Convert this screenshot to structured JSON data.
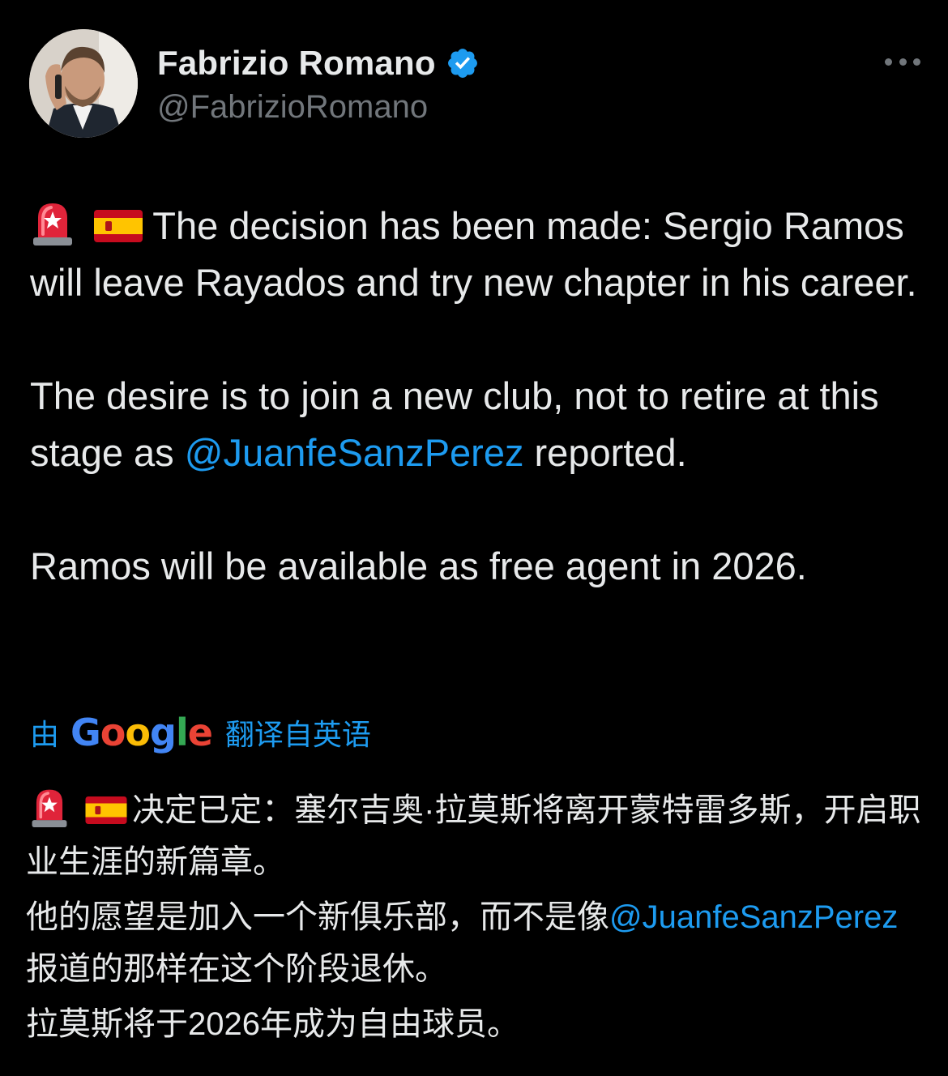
{
  "tweet": {
    "author": {
      "display_name": "Fabrizio Romano",
      "handle": "@FabrizioRomano",
      "verified": true
    },
    "more_icon": "more-horizontal-icon",
    "body": {
      "line1_text": " The decision has been made: Sergio Ramos will leave Rayados and try new chapter in his career.",
      "para2_before": "The desire is to join a new club, not to retire at this stage as ",
      "para2_mention": "@JuanfeSanzPerez",
      "para2_after": " reported.",
      "para3": "Ramos will be available as free agent in 2026."
    },
    "translation": {
      "by_label": "由",
      "provider": "Google",
      "label": "翻译自英语",
      "line1_text": "决定已定：塞尔吉奥·拉莫斯将离开蒙特雷多斯，开启职业生涯的新篇章。",
      "para2_before": "他的愿望是加入一个新俱乐部，而不是像",
      "para2_mention": "@JuanfeSanzPerez",
      "para2_after": "报道的那样在这个阶段退休。",
      "para3": "拉莫斯将于2026年成为自由球员。"
    },
    "emojis": [
      "police-light-icon",
      "spain-flag-icon"
    ],
    "colors": {
      "background": "#000000",
      "text": "#e7e9ea",
      "secondary": "#71767b",
      "accent": "#1d9bf0"
    }
  }
}
